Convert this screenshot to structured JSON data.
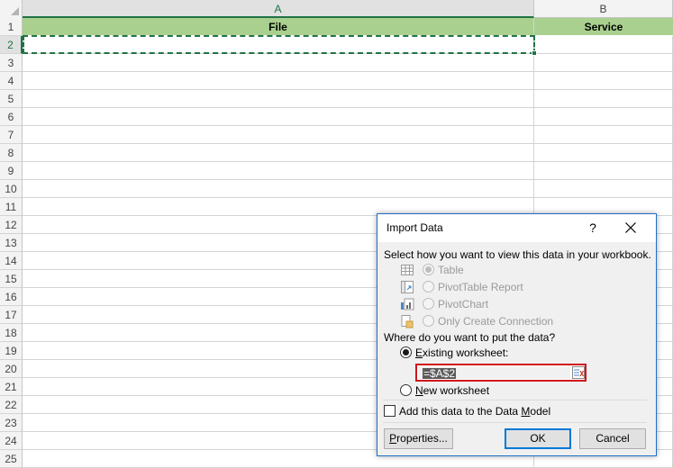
{
  "spreadsheet": {
    "columns": [
      "A",
      "B"
    ],
    "header_row": {
      "a": "File",
      "b": "Service"
    },
    "row_numbers": [
      "1",
      "2",
      "3",
      "4",
      "5",
      "6",
      "7",
      "8",
      "9",
      "10",
      "11",
      "12",
      "13",
      "14",
      "15",
      "16",
      "17",
      "18",
      "19",
      "20",
      "21",
      "22",
      "23",
      "24",
      "25"
    ],
    "colors": {
      "header_fill": "#a9d08e",
      "selection": "#217346"
    }
  },
  "dialog": {
    "title": "Import Data",
    "help_label": "?",
    "view_prompt": "Select how you want to view this data in your workbook.",
    "view_options": [
      {
        "label": "Table",
        "icon": "table-icon",
        "checked": true,
        "enabled": false
      },
      {
        "label": "PivotTable Report",
        "icon": "pivottable-icon",
        "checked": false,
        "enabled": false
      },
      {
        "label": "PivotChart",
        "icon": "pivotchart-icon",
        "checked": false,
        "enabled": false
      },
      {
        "label": "Only Create Connection",
        "icon": "connection-icon",
        "checked": false,
        "enabled": false
      }
    ],
    "put_prompt": "Where do you want to put the data?",
    "existing_label_accel": "E",
    "existing_label_rest": "xisting worksheet:",
    "range_value": "=$A$2",
    "new_label_accel": "N",
    "new_label_rest": "ew worksheet",
    "data_model_label_pre": "Add this data to the Data ",
    "data_model_label_accel": "M",
    "data_model_label_post": "odel",
    "buttons": {
      "properties_accel": "P",
      "properties_rest": "roperties...",
      "ok": "OK",
      "cancel": "Cancel"
    },
    "colors": {
      "accent": "#0078d7",
      "range_highlight": "#d0141c"
    }
  }
}
